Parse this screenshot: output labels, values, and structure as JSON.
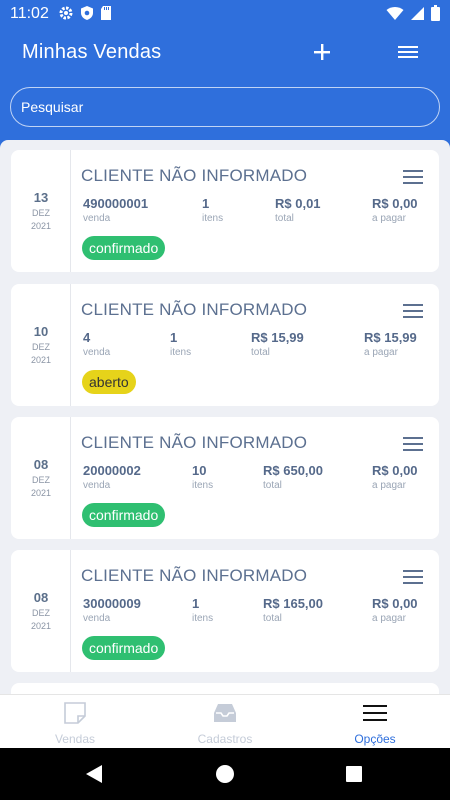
{
  "status_bar": {
    "time": "11:02"
  },
  "app_bar": {
    "title": "Minhas Vendas"
  },
  "search": {
    "placeholder": "Pesquisar"
  },
  "sales": [
    {
      "day": "13",
      "month": "DEZ",
      "year": "2021",
      "client": "CLIENTE NÃO INFORMADO",
      "venda": "490000001",
      "venda_label": "venda",
      "itens": "1",
      "itens_label": "itens",
      "total": "R$ 0,01",
      "total_label": "total",
      "a_pagar": "R$ 0,00",
      "a_pagar_label": "a pagar",
      "status": "confirmado"
    },
    {
      "day": "10",
      "month": "DEZ",
      "year": "2021",
      "client": "CLIENTE NÃO INFORMADO",
      "venda": "4",
      "venda_label": "venda",
      "itens": "1",
      "itens_label": "itens",
      "total": "R$ 15,99",
      "total_label": "total",
      "a_pagar": "R$ 15,99",
      "a_pagar_label": "a pagar",
      "status": "aberto"
    },
    {
      "day": "08",
      "month": "DEZ",
      "year": "2021",
      "client": "CLIENTE NÃO INFORMADO",
      "venda": "20000002",
      "venda_label": "venda",
      "itens": "10",
      "itens_label": "itens",
      "total": "R$ 650,00",
      "total_label": "total",
      "a_pagar": "R$ 0,00",
      "a_pagar_label": "a pagar",
      "status": "confirmado"
    },
    {
      "day": "08",
      "month": "DEZ",
      "year": "2021",
      "client": "CLIENTE NÃO INFORMADO",
      "venda": "30000009",
      "venda_label": "venda",
      "itens": "1",
      "itens_label": "itens",
      "total": "R$ 165,00",
      "total_label": "total",
      "a_pagar": "R$ 0,00",
      "a_pagar_label": "a pagar",
      "status": "confirmado"
    }
  ],
  "bottom_nav": {
    "items": [
      {
        "label": "Vendas",
        "icon": "note-icon",
        "active": false
      },
      {
        "label": "Cadastros",
        "icon": "inbox-icon",
        "active": false
      },
      {
        "label": "Opções",
        "icon": "menu-icon",
        "active": true
      }
    ]
  },
  "colors": {
    "primary": "#2f6fdc",
    "confirmado": "#2fbf71",
    "aberto": "#e6d31a",
    "nav_inactive": "#c5ccd8",
    "nav_active": "#2f6fdc"
  }
}
